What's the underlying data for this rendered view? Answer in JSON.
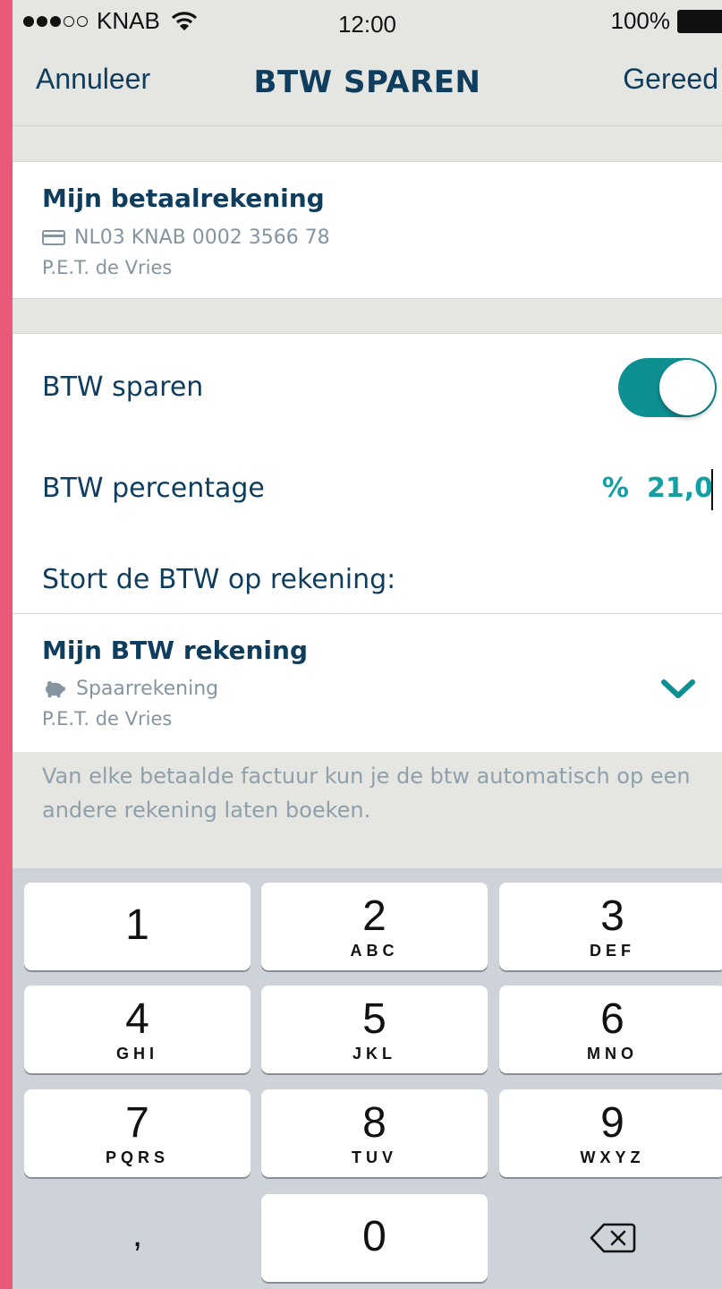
{
  "status_bar": {
    "carrier": "KNAB",
    "time": "12:00",
    "battery": "100%"
  },
  "nav": {
    "cancel_label": "Annuleer",
    "title": "BTW SPAREN",
    "done_label": "Gereed"
  },
  "source_account": {
    "name": "Mijn betaalrekening",
    "iban": "NL03 KNAB 0002 3566 78",
    "holder": "P.E.T. de Vries"
  },
  "settings": {
    "btw_sparen_label": "BTW sparen",
    "btw_sparen_enabled": true,
    "percentage_label": "BTW percentage",
    "percentage_symbol": "%",
    "percentage_value": "21,0",
    "deposit_label": "Stort de BTW op rekening:"
  },
  "target_account": {
    "name": "Mijn BTW rekening",
    "type": "Spaarrekening",
    "holder": "P.E.T. de Vries"
  },
  "info_text": "Van elke betaalde factuur kun je de btw automatisch op een andere rekening laten boeken.",
  "keypad": {
    "keys": [
      {
        "num": "1",
        "letters": ""
      },
      {
        "num": "2",
        "letters": "ABC"
      },
      {
        "num": "3",
        "letters": "DEF"
      },
      {
        "num": "4",
        "letters": "GHI"
      },
      {
        "num": "5",
        "letters": "JKL"
      },
      {
        "num": "6",
        "letters": "MNO"
      },
      {
        "num": "7",
        "letters": "PQRS"
      },
      {
        "num": "8",
        "letters": "TUV"
      },
      {
        "num": "9",
        "letters": "WXYZ"
      },
      {
        "num": "0",
        "letters": ""
      }
    ],
    "decimal": ","
  },
  "colors": {
    "navy": "#0f3d5e",
    "teal": "#0e8f91",
    "accent_pink": "#ea5a78"
  }
}
